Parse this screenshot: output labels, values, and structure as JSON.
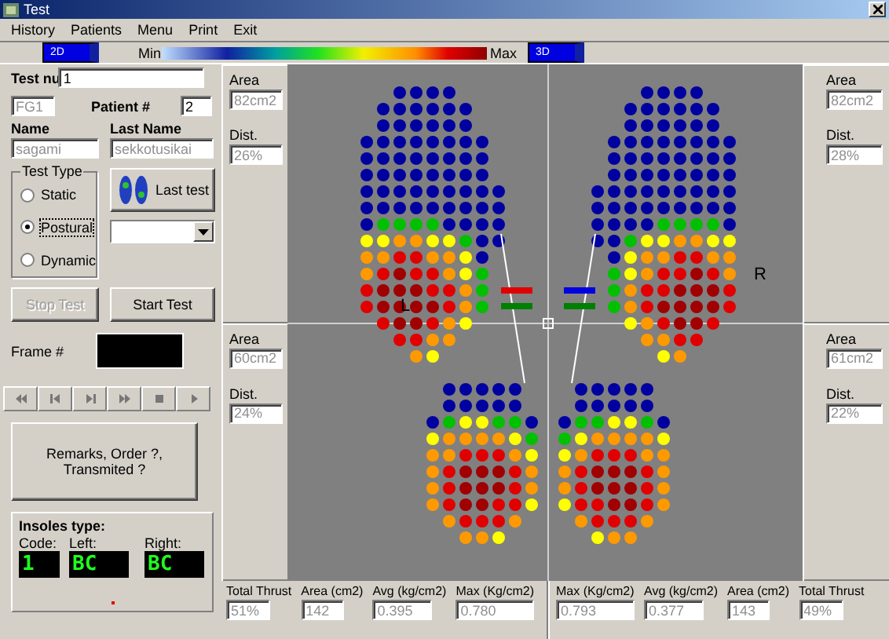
{
  "window": {
    "title": "Test"
  },
  "menu": [
    "History",
    "Patients",
    "Menu",
    "Print",
    "Exit"
  ],
  "toolbar": {
    "view_2d": "2D",
    "scale_min": "Min",
    "scale_max": "Max",
    "view_3d": "3D"
  },
  "patient": {
    "test_num_label": "Test nu",
    "test_num": "1",
    "code": "FG1",
    "patient_label": "Patient #",
    "patient_num": "2",
    "name_label": "Name",
    "name": "sagami",
    "last_name_label": "Last Name",
    "last_name": "sekkotusikai"
  },
  "test_type": {
    "title": "Test Type",
    "options": [
      {
        "label": "Static",
        "selected": false
      },
      {
        "label": "Postural",
        "selected": true
      },
      {
        "label": "Dynamic",
        "selected": false
      }
    ]
  },
  "last_test_button": "Last test",
  "stop_button": {
    "label": "Stop Test",
    "disabled": true
  },
  "start_button": {
    "label": "Start Test",
    "disabled": false
  },
  "frame_label": "Frame #",
  "remarks_button": "Remarks, Order ?, Transmited ?",
  "insoles": {
    "title": "Insoles type:",
    "code_label": "Code:",
    "left_label": "Left:",
    "right_label": "Right:",
    "code": "1",
    "left": "BC",
    "right": "BC"
  },
  "left_side": [
    {
      "area_label": "Area",
      "area": "82cm2",
      "dist_label": "Dist.",
      "dist": "26%"
    },
    {
      "area_label": "Area",
      "area": "60cm2",
      "dist_label": "Dist.",
      "dist": "24%"
    }
  ],
  "right_side": [
    {
      "area_label": "Area",
      "area": "82cm2",
      "dist_label": "Dist.",
      "dist": "28%"
    },
    {
      "area_label": "Area",
      "area": "61cm2",
      "dist_label": "Dist.",
      "dist": "22%"
    }
  ],
  "map": {
    "left_label": "L",
    "right_label": "R"
  },
  "stats_left": [
    {
      "label": "Total Thrust",
      "value": "51%"
    },
    {
      "label": "Area (cm2)",
      "value": "142"
    },
    {
      "label": "Avg (kg/cm2)",
      "value": "0.395"
    },
    {
      "label": "Max (Kg/cm2)",
      "value": "0.780"
    }
  ],
  "stats_right": [
    {
      "label": "Max (Kg/cm2)",
      "value": "0.793"
    },
    {
      "label": "Avg (kg/cm2)",
      "value": "0.377"
    },
    {
      "label": "Area (cm2)",
      "value": "143"
    },
    {
      "label": "Total Thrust",
      "value": "49%"
    }
  ]
}
